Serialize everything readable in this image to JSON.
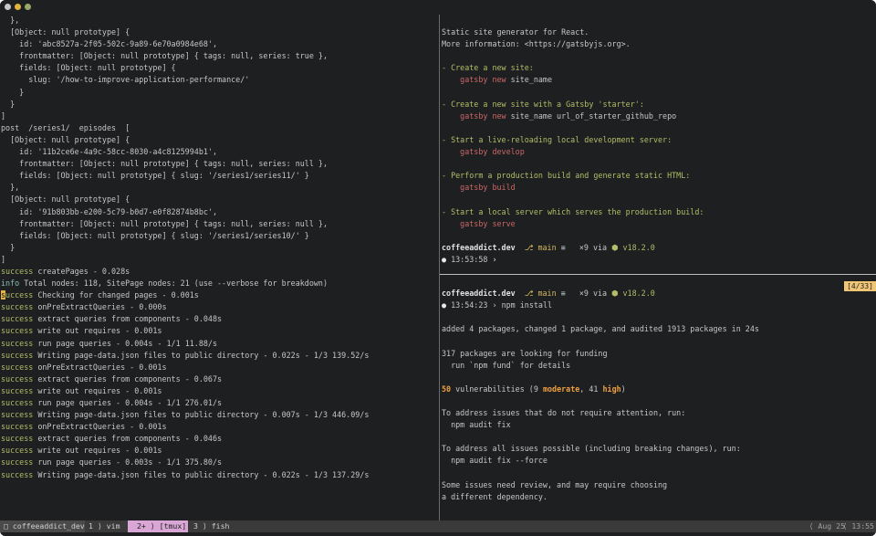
{
  "window": {
    "buttons": [
      "close",
      "minimize",
      "maximize"
    ]
  },
  "left_pane": {
    "lines": [
      [
        {
          "t": "  },"
        }
      ],
      [
        {
          "t": "  [Object: null prototype] {"
        }
      ],
      [
        {
          "t": "    id: 'abc8527a-2f05-502c-9a89-6e70a0984e68',"
        }
      ],
      [
        {
          "t": "    frontmatter: [Object: null prototype] { tags: null, series: true },"
        }
      ],
      [
        {
          "t": "    fields: [Object: null prototype] {"
        }
      ],
      [
        {
          "t": "      slug: '/how-to-improve-application-performance/'"
        }
      ],
      [
        {
          "t": "    }"
        }
      ],
      [
        {
          "t": "  }"
        }
      ],
      [
        {
          "t": "]"
        }
      ],
      [
        {
          "t": "post  /series1/  episodes  ["
        }
      ],
      [
        {
          "t": "  [Object: null prototype] {"
        }
      ],
      [
        {
          "t": "    id: '11b2ce6e-4a9c-58cc-8030-a4c8125994b1',"
        }
      ],
      [
        {
          "t": "    frontmatter: [Object: null prototype] { tags: null, series: null },"
        }
      ],
      [
        {
          "t": "    fields: [Object: null prototype] { slug: '/series1/series11/' }"
        }
      ],
      [
        {
          "t": "  },"
        }
      ],
      [
        {
          "t": "  [Object: null prototype] {"
        }
      ],
      [
        {
          "t": "    id: '91b803bb-e200-5c79-b0d7-e0f82874b8bc',"
        }
      ],
      [
        {
          "t": "    frontmatter: [Object: null prototype] { tags: null, series: null },"
        }
      ],
      [
        {
          "t": "    fields: [Object: null prototype] { slug: '/series1/series10/' }"
        }
      ],
      [
        {
          "t": "  }"
        }
      ],
      [
        {
          "t": "]"
        }
      ],
      [
        {
          "t": "success",
          "c": "green"
        },
        {
          "t": " createPages - 0.028s"
        }
      ],
      [
        {
          "t": "info",
          "c": "cyan"
        },
        {
          "t": " Total nodes: 118, SitePage nodes: 21 (use --verbose for breakdown)"
        }
      ],
      [
        {
          "t": "s",
          "c": "cursor"
        },
        {
          "t": "uccess",
          "c": "green"
        },
        {
          "t": " Checking for changed pages - 0.001s"
        }
      ],
      [
        {
          "t": "success",
          "c": "green"
        },
        {
          "t": " onPreExtractQueries - 0.000s"
        }
      ],
      [
        {
          "t": "success",
          "c": "green"
        },
        {
          "t": " extract queries from components - 0.048s"
        }
      ],
      [
        {
          "t": "success",
          "c": "green"
        },
        {
          "t": " write out requires - 0.001s"
        }
      ],
      [
        {
          "t": "success",
          "c": "green"
        },
        {
          "t": " run page queries - 0.004s - 1/1 11.88/s"
        }
      ],
      [
        {
          "t": "success",
          "c": "green"
        },
        {
          "t": " Writing page-data.json files to public directory - 0.022s - 1/3 139.52/s"
        }
      ],
      [
        {
          "t": "success",
          "c": "green"
        },
        {
          "t": " onPreExtractQueries - 0.001s"
        }
      ],
      [
        {
          "t": "success",
          "c": "green"
        },
        {
          "t": " extract queries from components - 0.067s"
        }
      ],
      [
        {
          "t": "success",
          "c": "green"
        },
        {
          "t": " write out requires - 0.001s"
        }
      ],
      [
        {
          "t": "success",
          "c": "green"
        },
        {
          "t": " run page queries - 0.004s - 1/1 276.01/s"
        }
      ],
      [
        {
          "t": "success",
          "c": "green"
        },
        {
          "t": " Writing page-data.json files to public directory - 0.007s - 1/3 446.09/s"
        }
      ],
      [
        {
          "t": "success",
          "c": "green"
        },
        {
          "t": " onPreExtractQueries - 0.001s"
        }
      ],
      [
        {
          "t": "success",
          "c": "green"
        },
        {
          "t": " extract queries from components - 0.046s"
        }
      ],
      [
        {
          "t": "success",
          "c": "green"
        },
        {
          "t": " write out requires - 0.001s"
        }
      ],
      [
        {
          "t": "success",
          "c": "green"
        },
        {
          "t": " run page queries - 0.003s - 1/1 375.80/s"
        }
      ],
      [
        {
          "t": "success",
          "c": "green"
        },
        {
          "t": " Writing page-data.json files to public directory - 0.022s - 1/3 137.29/s"
        }
      ]
    ]
  },
  "right_top_pane": {
    "lines": [
      [
        {
          "t": ""
        }
      ],
      [
        {
          "t": "Static site generator for React."
        }
      ],
      [
        {
          "t": "More information: <https://gatsbyjs.org>."
        }
      ],
      [
        {
          "t": ""
        }
      ],
      [
        {
          "t": "- Create a new site:",
          "c": "green"
        }
      ],
      [
        {
          "t": "    "
        },
        {
          "t": "gatsby new",
          "c": "red"
        },
        {
          "t": " site_name"
        }
      ],
      [
        {
          "t": ""
        }
      ],
      [
        {
          "t": "- Create a new site with a Gatsby 'starter':",
          "c": "green"
        }
      ],
      [
        {
          "t": "    "
        },
        {
          "t": "gatsby new",
          "c": "red"
        },
        {
          "t": " site_name url_of_starter_github_repo"
        }
      ],
      [
        {
          "t": ""
        }
      ],
      [
        {
          "t": "- Start a live-reloading local development server:",
          "c": "green"
        }
      ],
      [
        {
          "t": "    "
        },
        {
          "t": "gatsby develop",
          "c": "red"
        }
      ],
      [
        {
          "t": ""
        }
      ],
      [
        {
          "t": "- Perform a production build and generate static HTML:",
          "c": "green"
        }
      ],
      [
        {
          "t": "    "
        },
        {
          "t": "gatsby build",
          "c": "red"
        }
      ],
      [
        {
          "t": ""
        }
      ],
      [
        {
          "t": "- Start a local server which serves the production build:",
          "c": "green"
        }
      ],
      [
        {
          "t": "    "
        },
        {
          "t": "gatsby serve",
          "c": "red"
        }
      ],
      [
        {
          "t": ""
        }
      ],
      [
        {
          "t": "coffeeaddict.dev",
          "c": "bold"
        },
        {
          "t": "  ⎇ ",
          "c": "yellow"
        },
        {
          "t": "main",
          "c": "yellow"
        },
        {
          "t": " ≡   ×9 via "
        },
        {
          "t": "⬢ v18.2.0",
          "c": "green"
        }
      ],
      [
        {
          "t": "● ",
          "c": "white"
        },
        {
          "t": "13:53:58"
        },
        {
          "t": " ›",
          "c": "white"
        }
      ]
    ]
  },
  "right_bottom_pane": {
    "position_indicator": "[4/33]",
    "lines": [
      [
        {
          "t": ""
        }
      ],
      [
        {
          "t": "coffeeaddict.dev",
          "c": "bold"
        },
        {
          "t": "  ⎇ ",
          "c": "yellow"
        },
        {
          "t": "main",
          "c": "yellow"
        },
        {
          "t": " ≡   ×9 via "
        },
        {
          "t": "⬢ v18.2.0",
          "c": "green"
        }
      ],
      [
        {
          "t": "● ",
          "c": "white"
        },
        {
          "t": "13:54:23"
        },
        {
          "t": " › npm install"
        }
      ],
      [
        {
          "t": ""
        }
      ],
      [
        {
          "t": "added 4 packages, changed 1 package, and audited 1913 packages in 24s"
        }
      ],
      [
        {
          "t": ""
        }
      ],
      [
        {
          "t": "317 packages are looking for funding"
        }
      ],
      [
        {
          "t": "  run `npm fund` for details"
        }
      ],
      [
        {
          "t": ""
        }
      ],
      [
        {
          "t": "50",
          "c": "orange"
        },
        {
          "t": " vulnerabilities (9 "
        },
        {
          "t": "moderate",
          "c": "orange"
        },
        {
          "t": ", 41 "
        },
        {
          "t": "high",
          "c": "orange"
        },
        {
          "t": ")"
        }
      ],
      [
        {
          "t": ""
        }
      ],
      [
        {
          "t": "To address issues that do not require attention, run:"
        }
      ],
      [
        {
          "t": "  npm audit fix"
        }
      ],
      [
        {
          "t": ""
        }
      ],
      [
        {
          "t": "To address all issues possible (including breaking changes), run:"
        }
      ],
      [
        {
          "t": "  npm audit fix --force"
        }
      ],
      [
        {
          "t": ""
        }
      ],
      [
        {
          "t": "Some issues need review, and may require choosing"
        }
      ],
      [
        {
          "t": "a different dependency."
        }
      ]
    ]
  },
  "status_bar": {
    "session": "□ coffeeaddict_dev",
    "win1": "1 ⟩ vim",
    "win2": "2+ ⟩ [tmux]",
    "win3": "3 ⟩ fish",
    "date": "⟨ Aug 25",
    "time": "⟨ 13:55"
  }
}
